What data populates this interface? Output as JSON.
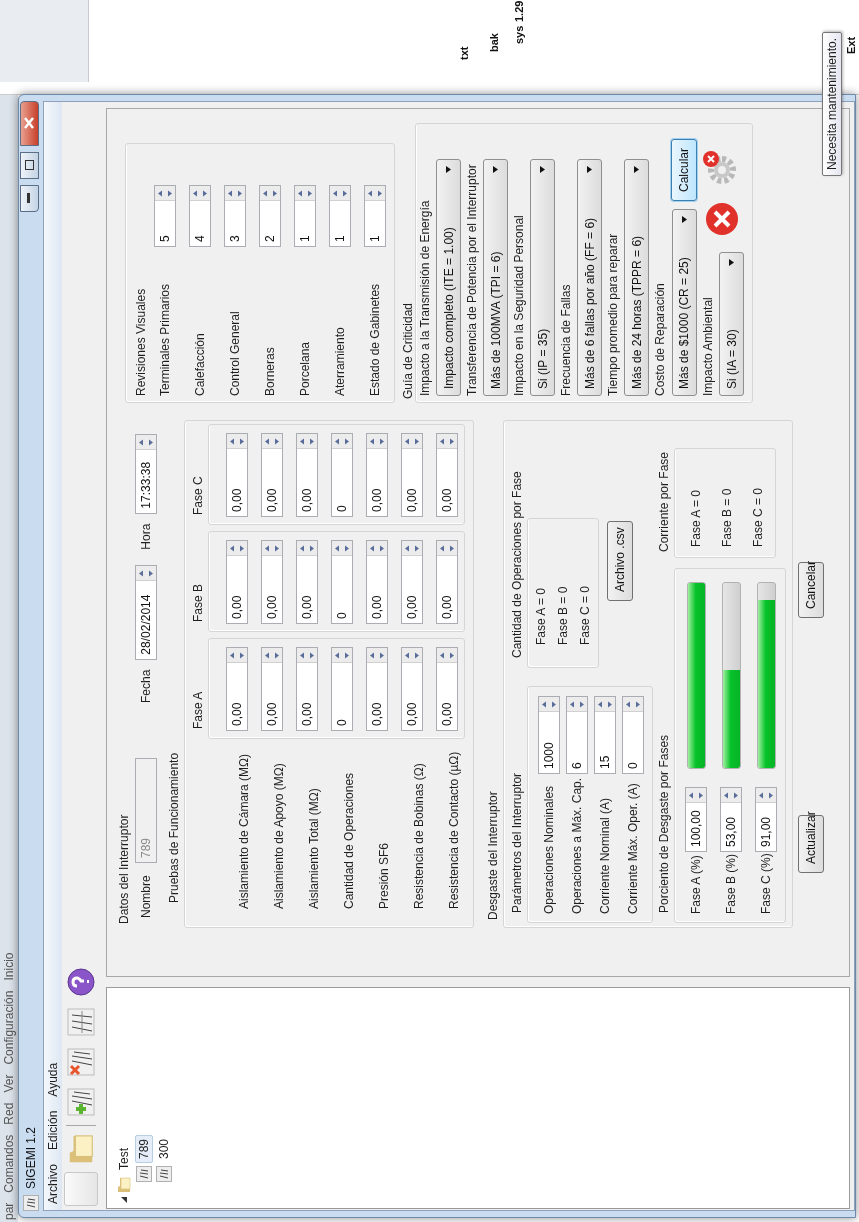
{
  "desktop_menu": [
    "par",
    "Comandos",
    "Red",
    "Ver",
    "Configuración",
    "Inicio"
  ],
  "background_window": {
    "column_header": "Ext",
    "files": [
      {
        "name": "txt"
      },
      {
        "name": "bak"
      },
      {
        "name": "sys",
        "size": "1.29"
      }
    ]
  },
  "window": {
    "title": "SIGEMI 1.2"
  },
  "menu": [
    "Archivo",
    "Edición",
    "Ayuda"
  ],
  "toolbar": [
    {
      "kind": "blank"
    },
    {
      "kind": "folder"
    },
    {
      "kind": "separator"
    },
    {
      "kind": "add"
    },
    {
      "kind": "delete"
    },
    {
      "kind": "chart"
    },
    {
      "kind": "help"
    }
  ],
  "tree": {
    "label": "Test",
    "expanded": true,
    "children": [
      {
        "label": "789",
        "selected": true
      },
      {
        "label": "300",
        "selected": false
      }
    ]
  },
  "datos": {
    "title": "Datos del Interruptor",
    "nombre": {
      "label": "Nombre",
      "value": "789",
      "disabled": true
    },
    "fecha": {
      "label": "Fecha",
      "value": "28/02/2014"
    },
    "hora": {
      "label": "Hora",
      "value": "17:33:38"
    }
  },
  "pruebas": {
    "title": "Pruebas de Funcionamiento",
    "rows": [
      "Aislamiento de Cámara (MΩ)",
      "Aislamiento de Apoyo (MΩ)",
      "Aislamiento Total (MΩ)",
      "Cantidad de Operaciones",
      "Presión SF6",
      "Resistencia de Bobinas (Ω)",
      "Resistencia de Contacto (µΩ)"
    ],
    "phases": [
      {
        "title": "Fase A",
        "values": [
          "0,00",
          "0,00",
          "0,00",
          "0",
          "0,00",
          "0,00",
          "0,00"
        ]
      },
      {
        "title": "Fase B",
        "values": [
          "0,00",
          "0,00",
          "0,00",
          "0",
          "0,00",
          "0,00",
          "0,00"
        ]
      },
      {
        "title": "Fase C",
        "values": [
          "0,00",
          "0,00",
          "0,00",
          "0",
          "0,00",
          "0,00",
          "0,00"
        ]
      }
    ]
  },
  "desgaste": {
    "title": "Desgaste del Interruptor",
    "parametros": {
      "title": "Parámetros del Interruptor",
      "rows": [
        {
          "label": "Operaciones Nominales",
          "value": "1000"
        },
        {
          "label": "Operaciones a Máx. Cap.",
          "value": "6"
        },
        {
          "label": "Corriente Nominal (A)",
          "value": "15"
        },
        {
          "label": "Corriente Máx. Oper. (A)",
          "value": "0"
        }
      ]
    },
    "cantidad": {
      "title": "Cantidad de Operaciones por Fase",
      "lines": [
        "Fase A = 0",
        "Fase B = 0",
        "Fase C = 0"
      ]
    },
    "archivo_button": "Archivo .csv",
    "porciento": {
      "title": "Porciento de Desgaste por Fases",
      "rows": [
        {
          "label": "Fase A (%)",
          "value": "100,00",
          "level": 1.0
        },
        {
          "label": "Fase B (%)",
          "value": "53,00",
          "level": 0.53
        },
        {
          "label": "Fase C (%)",
          "value": "91,00",
          "level": 0.91
        }
      ]
    },
    "corriente": {
      "title": "Corriente por Fase",
      "lines": [
        "Fase A = 0",
        "Fase B = 0",
        "Fase C = 0"
      ]
    }
  },
  "buttons": [
    "Actualizar",
    "Cancelar"
  ],
  "revisiones": {
    "title": "Revisiones Visuales",
    "rows": [
      {
        "label": "Terminales Primarios",
        "value": "5"
      },
      {
        "label": "Calefacción",
        "value": "4"
      },
      {
        "label": "Control General",
        "value": "3"
      },
      {
        "label": "Borneras",
        "value": "2"
      },
      {
        "label": "Porcelana",
        "value": "1"
      },
      {
        "label": "Aterramiento",
        "value": "1"
      },
      {
        "label": "Estado de Gabinetes",
        "value": "1"
      }
    ]
  },
  "guia": {
    "title": "Guía de Criticidad",
    "items": [
      {
        "label": "Impacto a la Transmisión de Energía",
        "value": "Impacto completo (ITE = 1.00)"
      },
      {
        "label": "Transferencia de Potencia por el Interruptor",
        "value": "Más de 100MVA (TPI = 6)"
      },
      {
        "label": "Impacto en la Seguridad Personal",
        "value": "Si (IP = 35)"
      },
      {
        "label": "Frecuencia de Fallas",
        "value": "Más de 6 fallas por año (FF = 6)"
      },
      {
        "label": "Tiempo promedio para reparar",
        "value": "Más de 24 horas (TPPR = 6)"
      },
      {
        "label": "Costo de Reparación",
        "value": "Más de $1000 (CR = 25)"
      },
      {
        "label": "Impacto Ambiental",
        "value": "Si (IA = 30)"
      }
    ],
    "calcular": "Calcular"
  },
  "tooltip": "Necesita mantenimiento."
}
